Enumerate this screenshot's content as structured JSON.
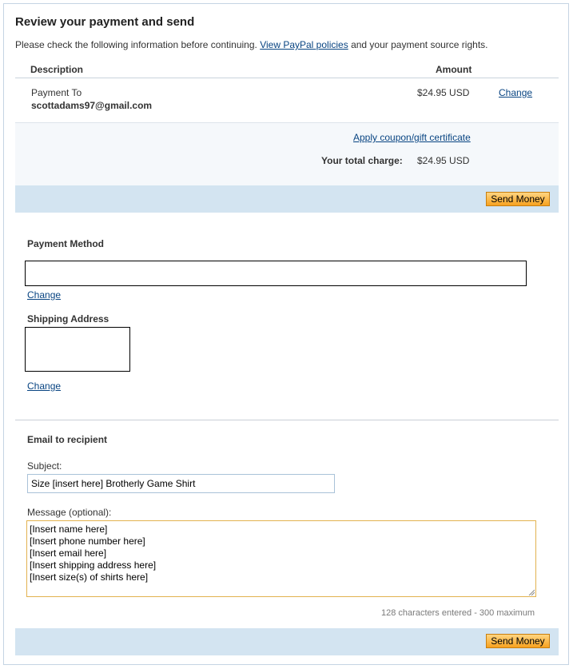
{
  "review": {
    "title": "Review your payment and send",
    "intro_text": "Please check the following information before continuing.",
    "policies_link": "View PayPal policies",
    "intro_suffix": "and your payment source rights."
  },
  "table": {
    "headers": {
      "description": "Description",
      "amount": "Amount"
    },
    "row": {
      "label": "Payment To",
      "recipient": "scottadams97@gmail.com",
      "amount": "$24.95 USD",
      "change": "Change"
    }
  },
  "summary": {
    "coupon_link": "Apply coupon/gift certificate",
    "total_label": "Your total charge:",
    "total_value": "$24.95 USD"
  },
  "buttons": {
    "send_money": "Send Money"
  },
  "payment_method": {
    "heading": "Payment Method",
    "change": "Change"
  },
  "shipping": {
    "heading": "Shipping Address",
    "change": "Change"
  },
  "email": {
    "heading": "Email to recipient",
    "subject_label": "Subject:",
    "subject_value": "Size [insert here] Brotherly Game Shirt",
    "message_label": "Message (optional):",
    "message_value": "[Insert name here]\n[Insert phone number here]\n[Insert email here]\n[Insert shipping address here]\n[Insert size(s) of shirts here]",
    "counter": "128 characters entered - 300 maximum"
  },
  "colors": {
    "link": "#084482",
    "action_bar": "#d3e4f1",
    "button": "#f7a11f",
    "summary_bg": "#f5f8fb"
  }
}
